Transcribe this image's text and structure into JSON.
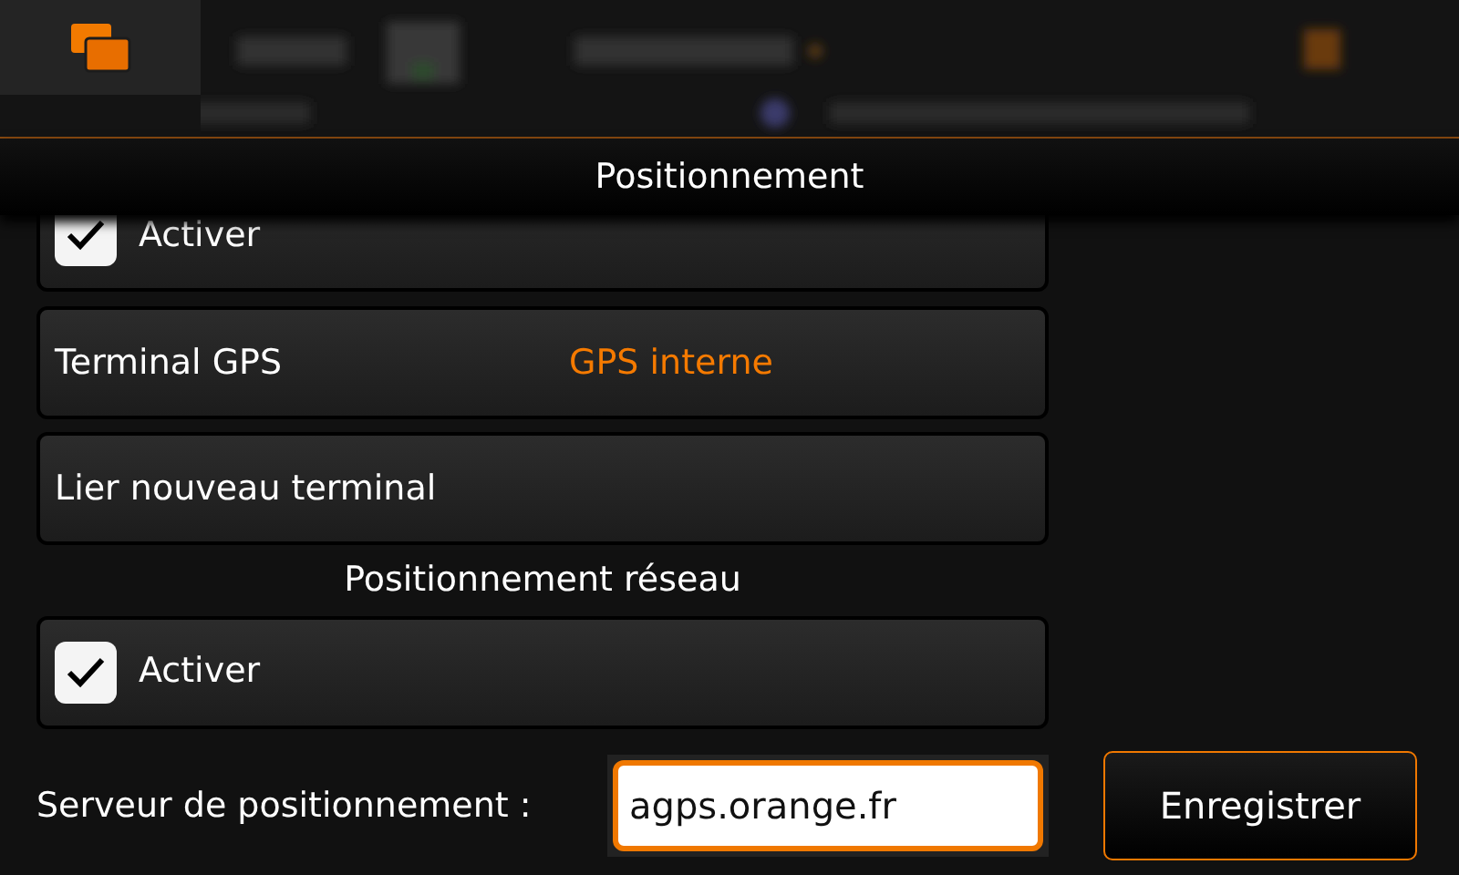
{
  "dialog": {
    "title": "Positionnement"
  },
  "items": [
    {
      "kind": "checkbox",
      "label": "Activer",
      "checked": true
    },
    {
      "kind": "value",
      "label": "Terminal GPS",
      "value": "GPS interne"
    },
    {
      "kind": "button",
      "label": "Lier nouveau terminal"
    },
    {
      "kind": "heading",
      "label": "Positionnement réseau"
    },
    {
      "kind": "checkbox",
      "label": "Activer",
      "checked": true
    }
  ],
  "server": {
    "label": "Serveur de positionnement :",
    "value": "agps.orange.fr"
  },
  "save_button": "Enregistrer"
}
